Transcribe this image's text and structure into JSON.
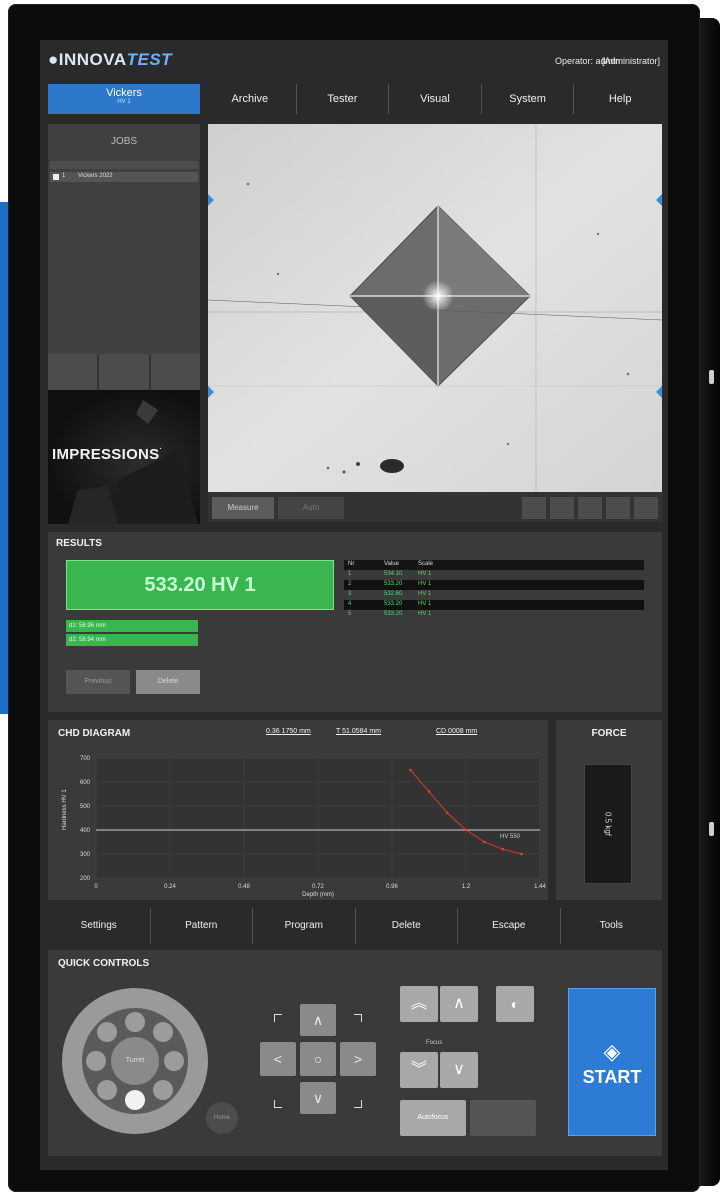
{
  "header": {
    "logo_prefix": "●INNOVA",
    "logo_suffix": "TEST",
    "operator": "Operator: admin",
    "role": "[Administrator]"
  },
  "method": {
    "label": "Vickers",
    "sub": "HV 1"
  },
  "menu": [
    "Archive",
    "Tester",
    "Visual",
    "System",
    "Help"
  ],
  "jobs": {
    "title": "JOBS",
    "rows": [
      {
        "number": "1",
        "name": "Vickers 2022"
      }
    ]
  },
  "brand": {
    "label": "IMPRESSIONS"
  },
  "viewer": {
    "buttons": [
      "Measure",
      "Auto"
    ]
  },
  "results": {
    "title": "RESULTS",
    "main_value": "533.20 HV 1",
    "sub_values": [
      "d1: 58.96 mm",
      "d2: 58.94 mm"
    ],
    "buttons": [
      "Previous",
      "Delete"
    ],
    "table_headers": [
      "Nr",
      "Value",
      "Scale"
    ],
    "table_rows": [
      [
        "1",
        "534.10",
        "HV 1"
      ],
      [
        "2",
        "533.20",
        "HV 1"
      ],
      [
        "3",
        "532.60",
        "HV 1"
      ],
      [
        "4",
        "533.20",
        "HV 1"
      ],
      [
        "5",
        "533.20",
        "HV 1"
      ]
    ]
  },
  "chd": {
    "title": "CHD DIAGRAM",
    "stats": [
      "0.36 1750 mm",
      "T 51.0584 mm",
      "CD 0008 mm"
    ],
    "ylabel": "Hardness HV 1",
    "xlabel": "Depth (mm)"
  },
  "chart_data": {
    "type": "line",
    "title": "CHD DIAGRAM",
    "xlabel": "Depth (mm)",
    "ylabel": "Hardness HV 1",
    "x_ticks": [
      "0",
      "0.24",
      "0.48",
      "0.72",
      "0.96",
      "1.2",
      "1.44"
    ],
    "y_ticks": [
      "700",
      "600",
      "500",
      "400",
      "300",
      "200"
    ],
    "xlim": [
      0,
      1.44
    ],
    "ylim": [
      200,
      700
    ],
    "threshold": {
      "value": 400,
      "label": "HV 550"
    },
    "series": [
      {
        "x": [
          1.02,
          1.08,
          1.14,
          1.2,
          1.26,
          1.32,
          1.38
        ],
        "values": [
          650,
          560,
          470,
          400,
          350,
          320,
          300
        ]
      }
    ],
    "grid": true
  },
  "force": {
    "title": "FORCE",
    "value": "0.5 kgf"
  },
  "bottom_menu": [
    "Settings",
    "Pattern",
    "Program",
    "Delete",
    "Escape",
    "Tools"
  ],
  "quick": {
    "title": "QUICK CONTROLS",
    "wheel_center": "Turret",
    "wheel_side": "Home",
    "focus_label": "Focus",
    "autofocus": "Autofocus",
    "start_label": "START",
    "colors": {
      "start": "#2e7bd6",
      "result": "#39b64f",
      "method": "#2e78cc"
    }
  }
}
